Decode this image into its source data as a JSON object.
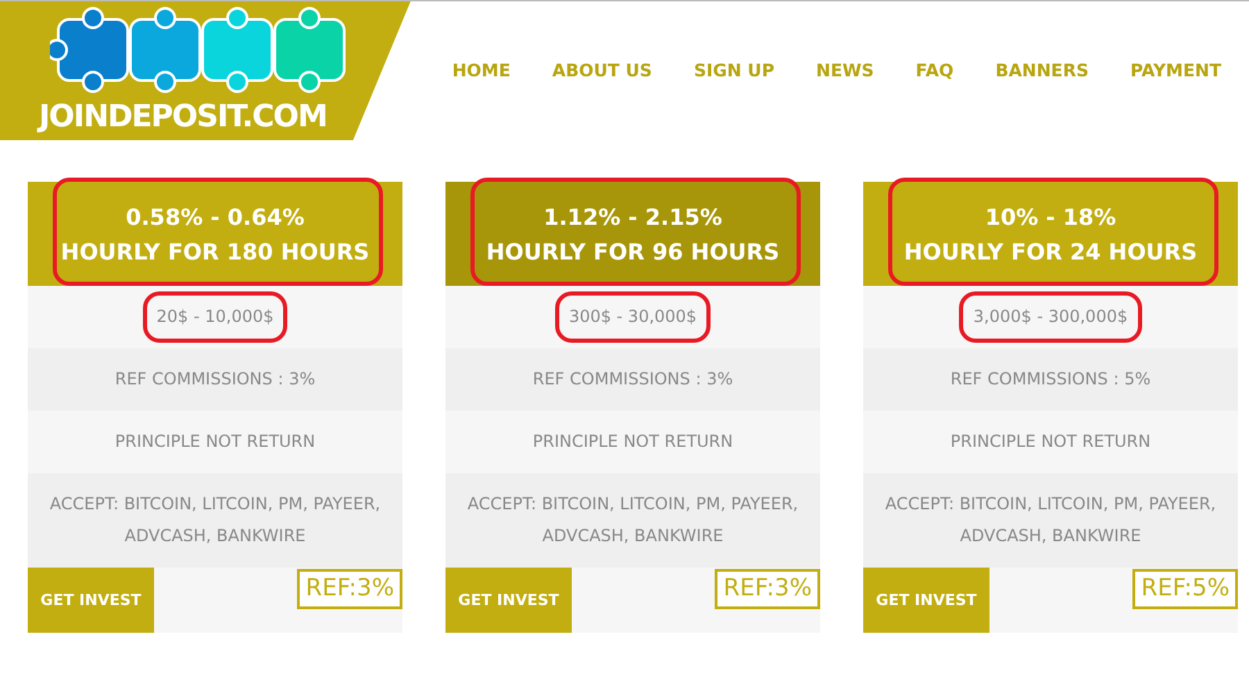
{
  "logo": {
    "text": "JOINDEPOSIT.COM"
  },
  "nav": [
    "HOME",
    "ABOUT US",
    "SIGN UP",
    "NEWS",
    "FAQ",
    "BANNERS",
    "PAYMENT"
  ],
  "plans": [
    {
      "rate": "0.58% - 0.64%",
      "term": "HOURLY FOR 180 HOURS",
      "highlighted": false,
      "range": "20$ - 10,000$",
      "marked": true,
      "ref": "REF COMMISSIONS : 3%",
      "principle": "PRINCIPLE NOT RETURN",
      "accept": "ACCEPT: BITCOIN, LITCOIN, PM, PAYEER, ADVCASH, BANKWIRE",
      "button": "GET INVEST",
      "badge": "REF:3%"
    },
    {
      "rate": "1.12% - 2.15%",
      "term": "HOURLY FOR 96 HOURS",
      "highlighted": true,
      "range": "300$ - 30,000$",
      "marked": true,
      "ref": "REF COMMISSIONS : 3%",
      "principle": "PRINCIPLE NOT RETURN",
      "accept": "ACCEPT: BITCOIN, LITCOIN, PM, PAYEER, ADVCASH, BANKWIRE",
      "button": "GET INVEST",
      "badge": "REF:3%"
    },
    {
      "rate": "10% - 18%",
      "term": "HOURLY FOR 24 HOURS",
      "highlighted": false,
      "range": "3,000$ - 300,000$",
      "marked": true,
      "ref": "REF COMMISSIONS : 5%",
      "principle": "PRINCIPLE NOT RETURN",
      "accept": "ACCEPT: BITCOIN, LITCOIN, PM, PAYEER, ADVCASH, BANKWIRE",
      "button": "GET INVEST",
      "badge": "REF:5%"
    }
  ]
}
